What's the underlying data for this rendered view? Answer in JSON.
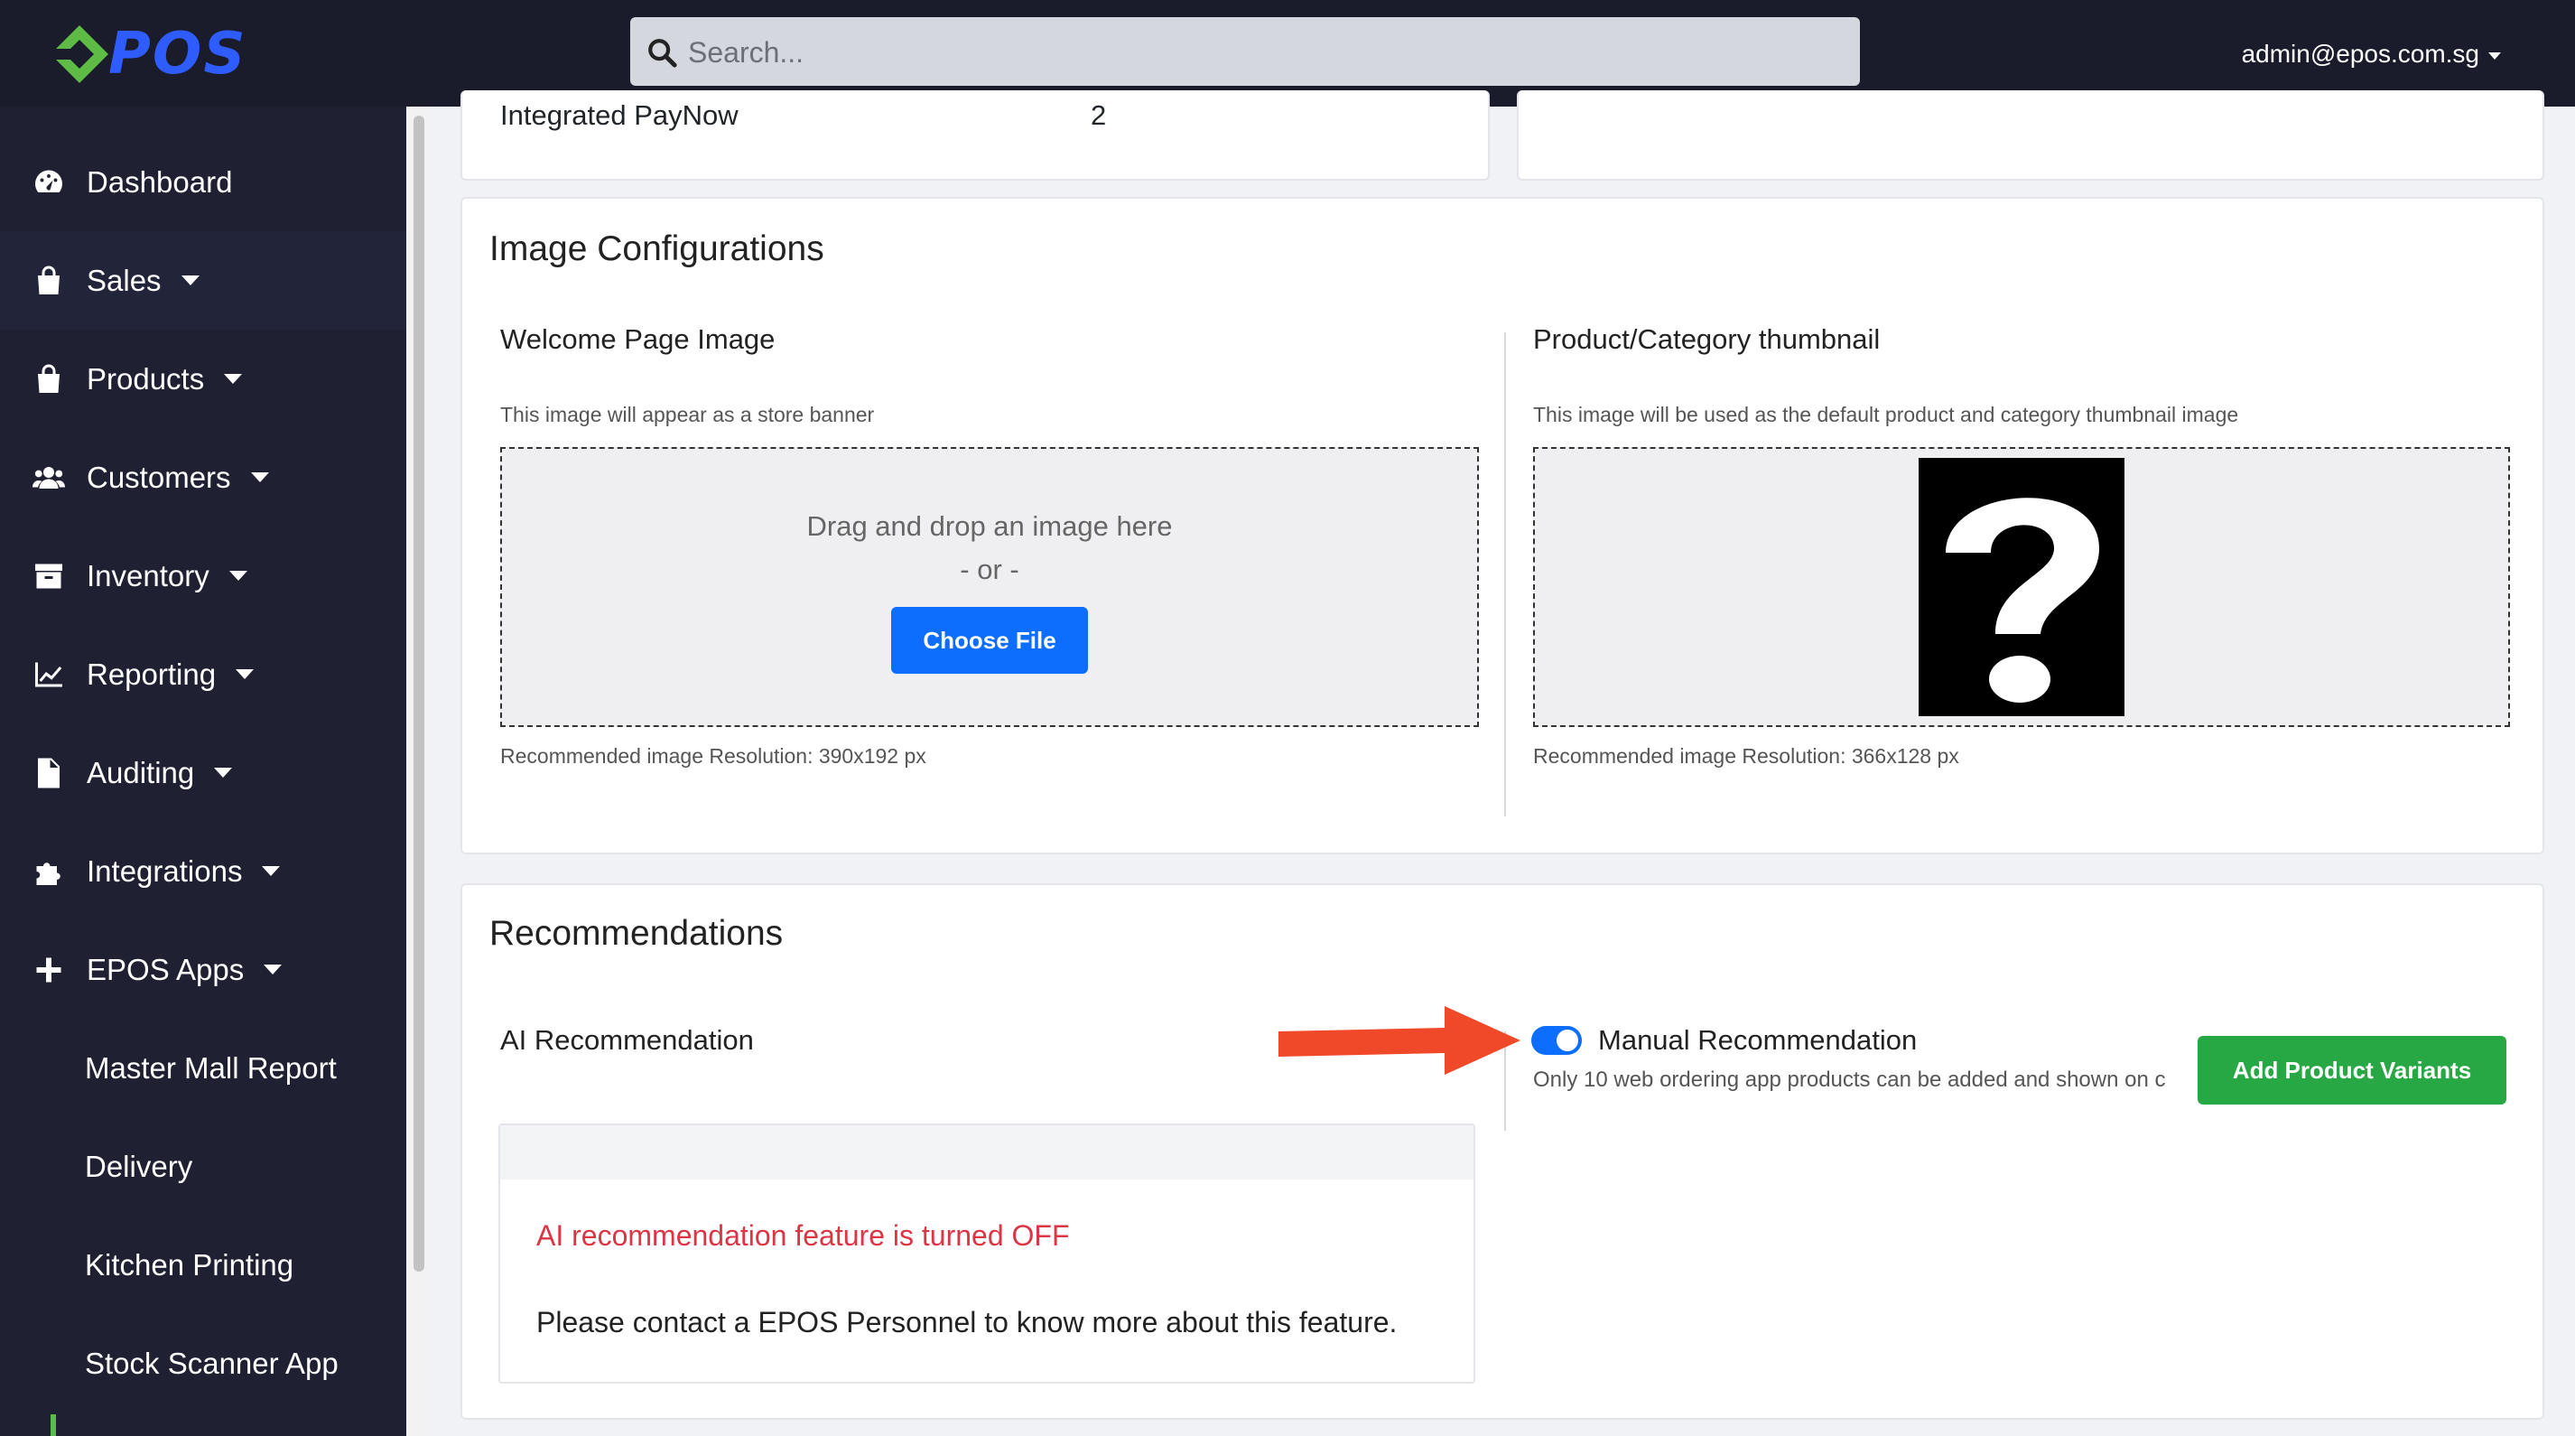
{
  "topbar": {
    "logo_text": "POS",
    "search_placeholder": "Search...",
    "user_email": "admin@epos.com.sg"
  },
  "sidebar": {
    "items": [
      {
        "label": "Dashboard",
        "icon": "dashboard-icon",
        "dropdown": false
      },
      {
        "label": "Sales",
        "icon": "shopping-bag-icon",
        "dropdown": true
      },
      {
        "label": "Products",
        "icon": "shopping-bag-icon",
        "dropdown": true
      },
      {
        "label": "Customers",
        "icon": "users-icon",
        "dropdown": true
      },
      {
        "label": "Inventory",
        "icon": "archive-box-icon",
        "dropdown": true
      },
      {
        "label": "Reporting",
        "icon": "line-chart-icon",
        "dropdown": true
      },
      {
        "label": "Auditing",
        "icon": "file-icon",
        "dropdown": true
      },
      {
        "label": "Integrations",
        "icon": "puzzle-icon",
        "dropdown": true
      },
      {
        "label": "EPOS Apps",
        "icon": "plus-icon",
        "dropdown": true
      },
      {
        "label": "Master Mall Report"
      },
      {
        "label": "Delivery"
      },
      {
        "label": "Kitchen Printing"
      },
      {
        "label": "Stock Scanner App"
      }
    ]
  },
  "top_card": {
    "label": "Integrated PayNow",
    "value": "2"
  },
  "image_config": {
    "title": "Image Configurations",
    "welcome": {
      "title": "Welcome Page Image",
      "help": "This image will appear as a store banner",
      "drag_text": "Drag and drop an image here",
      "or_text": "- or -",
      "button": "Choose File",
      "resolution": "Recommended image Resolution: 390x192 px"
    },
    "thumbnail": {
      "title": "Product/Category thumbnail",
      "help": "This image will be used as the default product and category thumbnail image",
      "resolution": "Recommended image Resolution: 366x128 px"
    }
  },
  "recommendations": {
    "title": "Recommendations",
    "ai_label": "AI Recommendation",
    "ai_off": "AI recommendation feature is turned OFF",
    "ai_contact": "Please contact a EPOS Personnel to know more about this feature.",
    "manual_label": "Manual Recommendation",
    "manual_help": "Only 10 web ordering app products can be added and shown on c",
    "manual_enabled": true,
    "add_button": "Add Product Variants"
  },
  "colors": {
    "topbar": "#1a1c2b",
    "sidebar": "#1f2133",
    "primary": "#0d6efd",
    "success": "#27a844",
    "danger": "#dc3545",
    "arrow": "#f0492a",
    "logo_green": "#5dbb46",
    "logo_blue": "#2f5cff"
  }
}
